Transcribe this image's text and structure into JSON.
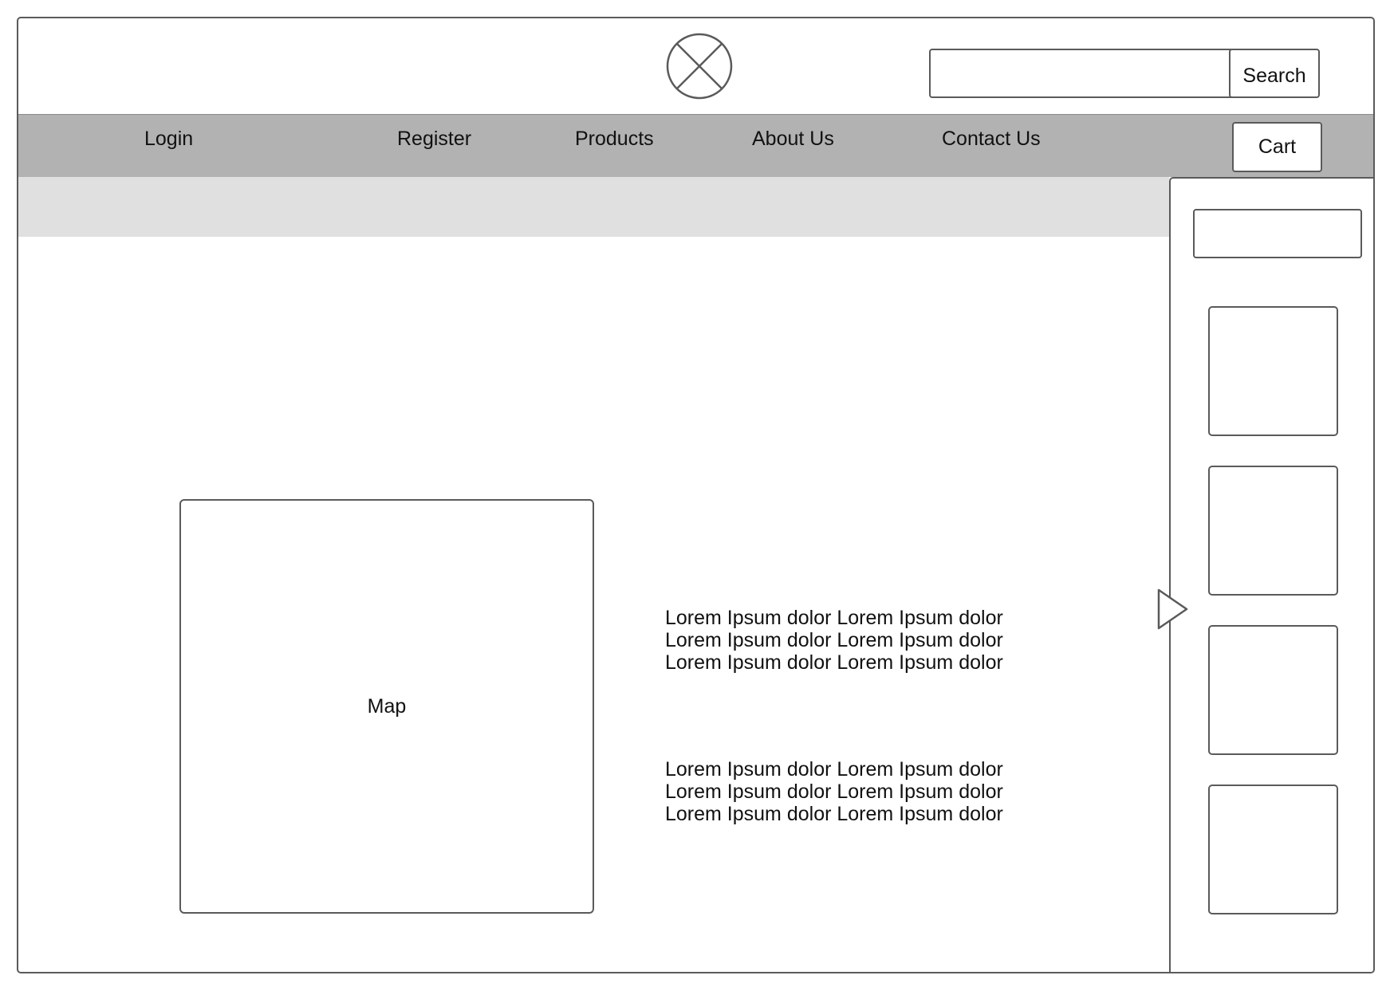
{
  "header": {
    "logo_icon": "close-circle-icon",
    "search": {
      "value": "",
      "button_label": "Search"
    }
  },
  "nav": {
    "items": [
      {
        "label": "Login"
      },
      {
        "label": "Register"
      },
      {
        "label": "Products"
      },
      {
        "label": "About Us"
      },
      {
        "label": "Contact Us"
      }
    ],
    "cart_label": "Cart"
  },
  "main": {
    "map_label": "Map",
    "paragraphs": [
      "Lorem Ipsum dolor Lorem Ipsum dolor Lorem Ipsum dolor Lorem Ipsum dolor Lorem Ipsum dolor Lorem Ipsum dolor",
      "Lorem Ipsum dolor Lorem Ipsum dolor Lorem Ipsum dolor Lorem Ipsum dolor Lorem Ipsum dolor Lorem Ipsum dolor"
    ]
  },
  "sidebar": {
    "input_value": "",
    "card_count": 4,
    "toggle_icon": "triangle-right-icon"
  },
  "colors": {
    "navbar_bg": "#b2b2b2",
    "banner_bg": "#e0e0e0",
    "stroke": "#5a5a5a"
  }
}
